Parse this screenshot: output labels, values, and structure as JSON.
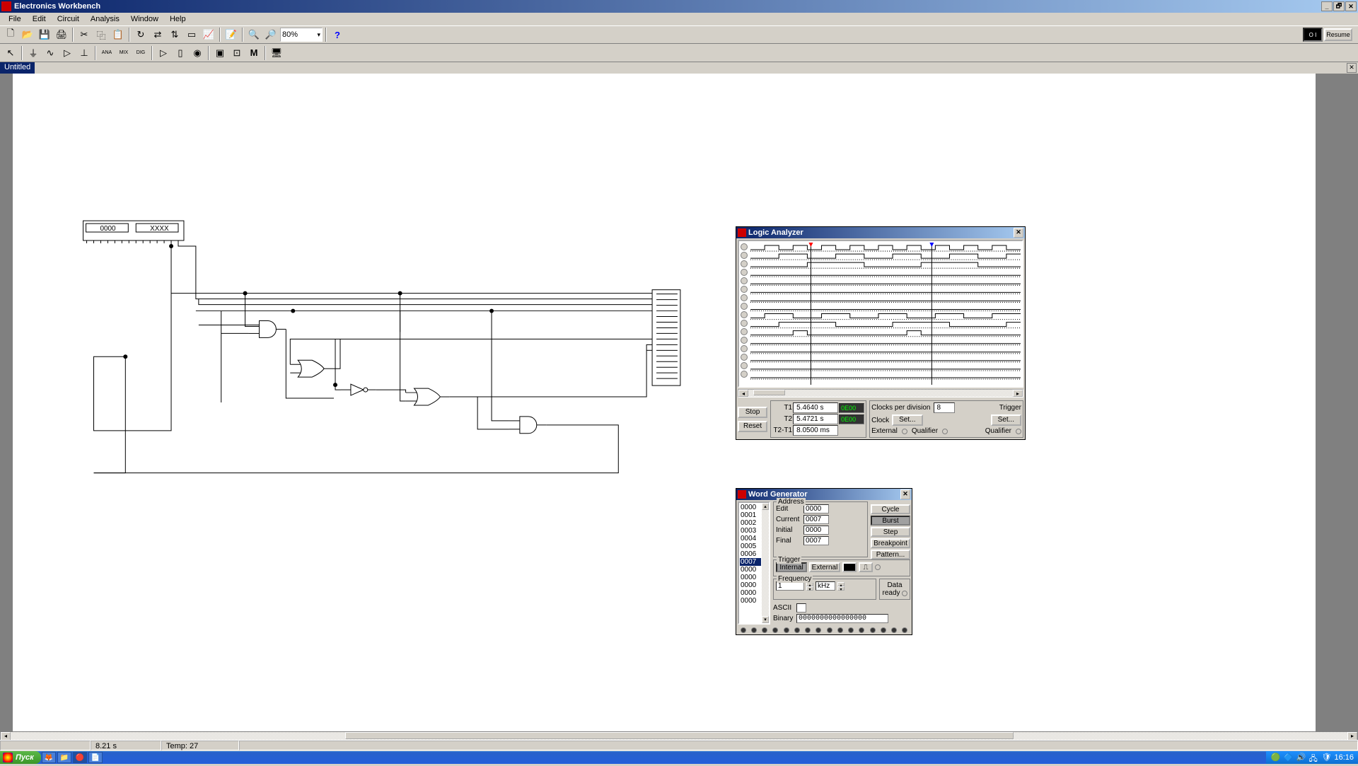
{
  "app": {
    "title": "Electronics Workbench"
  },
  "menu": {
    "items": [
      "File",
      "Edit",
      "Circuit",
      "Analysis",
      "Window",
      "Help"
    ]
  },
  "toolbar": {
    "zoom": "80%",
    "help": "?",
    "resume": "Resume"
  },
  "document": {
    "title": "Untitled"
  },
  "word_gen_icon": {
    "left": "0000",
    "right": "XXXX"
  },
  "status": {
    "time": "8.21 s",
    "temp": "Temp: 27"
  },
  "taskbar": {
    "start": "Пуск",
    "clock": "16:16"
  },
  "logic_analyzer": {
    "title": "Logic Analyzer",
    "stop": "Stop",
    "reset": "Reset",
    "t1_label": "T1",
    "t2_label": "T2",
    "t2t1_label": "T2-T1",
    "t1": "5.4640  s",
    "t2": "5.4721  s",
    "dt": "8.0500 ms",
    "t1hex": "0E00",
    "t2hex": "0E00",
    "clocks_per_div_label": "Clocks per division",
    "clocks_per_div": "8",
    "clock_label": "Clock",
    "set": "Set...",
    "external_label": "External",
    "qualifier_label": "Qualifier",
    "trigger_label": "Trigger"
  },
  "word_generator": {
    "title": "Word Generator",
    "list": [
      "0000",
      "0001",
      "0002",
      "0003",
      "0004",
      "0005",
      "0006",
      "0007",
      "0000",
      "0000",
      "0000",
      "0000",
      "0000"
    ],
    "selected_index": 7,
    "address_label": "Address",
    "edit_label": "Edit",
    "edit": "0000",
    "current_label": "Current",
    "current": "0007",
    "initial_label": "Initial",
    "initial": "0000",
    "final_label": "Final",
    "final": "0007",
    "cycle": "Cycle",
    "burst": "Burst",
    "step": "Step",
    "breakpoint": "Breakpoint",
    "pattern": "Pattern...",
    "trigger_label": "Trigger",
    "internal": "Internal",
    "external": "External",
    "frequency_label": "Frequency",
    "freq": "1",
    "freq_unit": "kHz",
    "data_label": "Data",
    "ready_label": "ready",
    "ascii_label": "ASCII",
    "ascii": "",
    "binary_label": "Binary",
    "binary": "0000000000000000"
  }
}
